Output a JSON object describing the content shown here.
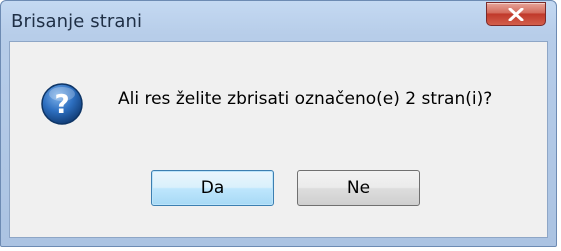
{
  "dialog": {
    "title": "Brisanje strani",
    "message": "Ali res želite zbrisati označeno(e) 2 stran(i)?",
    "icon": "question-icon",
    "buttons": {
      "yes_label": "Da",
      "no_label": "Ne"
    },
    "close_icon": "close-icon"
  },
  "colors": {
    "frame": "#b7cde9",
    "client_bg": "#f0f0f0",
    "close_button": "#c0392b",
    "question_icon": "#1f5fa8"
  }
}
